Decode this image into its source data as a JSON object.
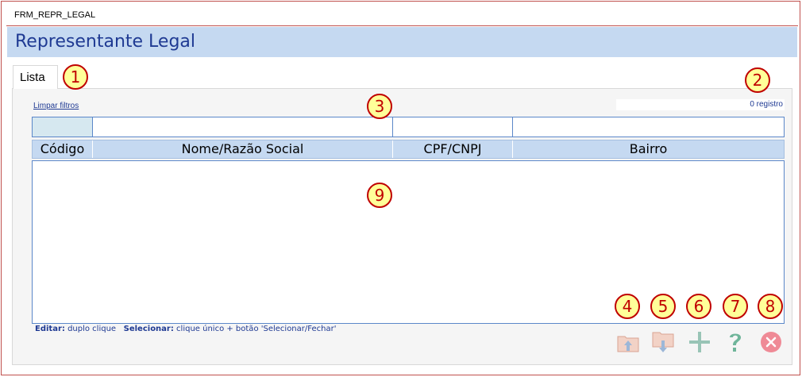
{
  "window": {
    "title": "FRM_REPR_LEGAL"
  },
  "header": {
    "title": "Representante Legal"
  },
  "tabs": [
    {
      "label": "Lista"
    }
  ],
  "toolbar": {
    "clear_filters": "Limpar filtros",
    "record_count": "0 registro"
  },
  "filters": {
    "codigo": "",
    "nome": "",
    "cpf_cnpj": "",
    "bairro": ""
  },
  "table": {
    "columns": [
      "Código",
      "Nome/Razão Social",
      "CPF/CNPJ",
      "Bairro"
    ],
    "rows": []
  },
  "hint": {
    "edit_label": "Editar:",
    "edit_text": "duplo clique",
    "select_label": "Selecionar:",
    "select_text": "clique único + botão 'Selecionar/Fechar'"
  },
  "callouts": [
    "1",
    "2",
    "3",
    "4",
    "5",
    "6",
    "7",
    "8",
    "9"
  ],
  "buttons": [
    {
      "icon": "import-folder-icon"
    },
    {
      "icon": "export-folder-icon"
    },
    {
      "icon": "add-icon"
    },
    {
      "icon": "help-icon"
    },
    {
      "icon": "close-icon"
    }
  ],
  "colors": {
    "accent": "#1f3a93",
    "header_band": "#c5d9f1",
    "callout_border": "#c00000",
    "callout_fill": "#ffff99"
  }
}
